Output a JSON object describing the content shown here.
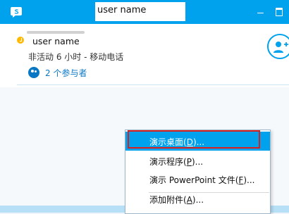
{
  "window": {
    "title": "user name"
  },
  "contact": {
    "name_prefix": "1",
    "name": "user name",
    "status": "非活动 6 小时 - 移动电话",
    "participants": "2 个参与者"
  },
  "menu": {
    "items": [
      {
        "label": "演示桌面",
        "mnemonic": "D",
        "suffix": "..."
      },
      {
        "label": "演示程序",
        "mnemonic": "P",
        "suffix": "..."
      },
      {
        "label": "演示 PowerPoint 文件",
        "mnemonic": "F",
        "suffix": "..."
      },
      {
        "label": "添加附件",
        "mnemonic": "A",
        "suffix": "..."
      }
    ]
  },
  "colors": {
    "accent": "#00a2ed",
    "highlight_outline": "#d9201e",
    "presence": "#ffb900"
  },
  "icons": {
    "app": "skype-icon",
    "add_person": "add-person-icon",
    "participants": "people-icon"
  }
}
